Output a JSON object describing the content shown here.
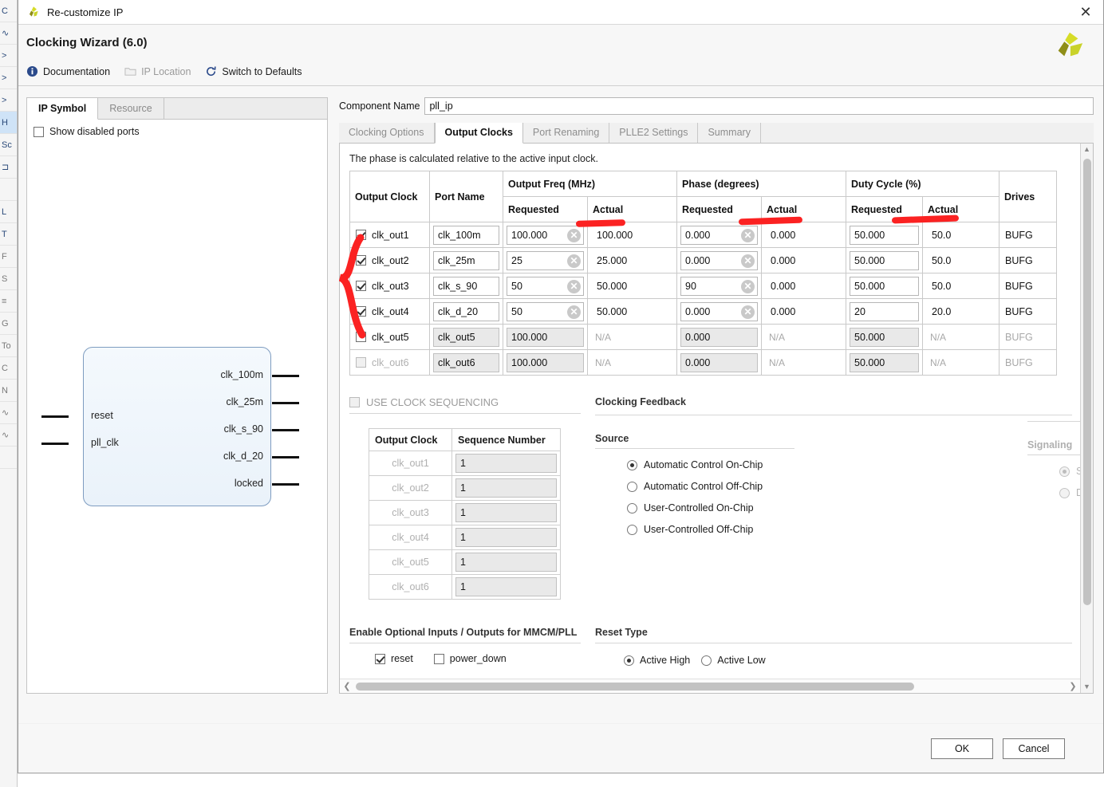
{
  "window": {
    "title": "Re-customize IP",
    "close_label": "✕",
    "icon": "xilinx-logo-icon"
  },
  "header": {
    "wizard_title": "Clocking Wizard (6.0)",
    "logo": "xilinx-logo-icon"
  },
  "toolbar": {
    "items": [
      {
        "label": "Documentation",
        "icon": "info-icon",
        "disabled": false
      },
      {
        "label": "IP Location",
        "icon": "folder-icon",
        "disabled": true
      },
      {
        "label": "Switch to Defaults",
        "icon": "refresh-icon",
        "disabled": false
      }
    ]
  },
  "left_panel": {
    "tabs": [
      {
        "label": "IP Symbol",
        "active": true
      },
      {
        "label": "Resource",
        "active": false
      }
    ],
    "show_disabled_ports": {
      "label": "Show disabled ports",
      "checked": false
    },
    "symbol": {
      "inputs": [
        "reset",
        "pll_clk"
      ],
      "outputs": [
        "clk_100m",
        "clk_25m",
        "clk_s_90",
        "clk_d_20",
        "locked"
      ]
    }
  },
  "component": {
    "label": "Component Name",
    "value": "pll_ip"
  },
  "tabs": [
    {
      "label": "Clocking Options",
      "active": false
    },
    {
      "label": "Output Clocks",
      "active": true
    },
    {
      "label": "Port Renaming",
      "active": false
    },
    {
      "label": "PLLE2 Settings",
      "active": false
    },
    {
      "label": "Summary",
      "active": false
    }
  ],
  "output_clocks": {
    "note": "The phase is calculated relative to the active input clock.",
    "group_headers": {
      "output_clock": "Output Clock",
      "port_name": "Port Name",
      "output_freq": "Output Freq (MHz)",
      "phase": "Phase (degrees)",
      "duty_cycle": "Duty Cycle (%)",
      "drives": "Drives"
    },
    "sub_headers": {
      "requested": "Requested",
      "actual": "Actual"
    },
    "na": "N/A",
    "rows": [
      {
        "name": "clk_out1",
        "checked": true,
        "enabled": true,
        "port": "clk_100m",
        "freq_req": "100.000",
        "freq_act": "100.000",
        "phase_req": "0.000",
        "phase_act": "0.000",
        "duty_req": "50.000",
        "duty_act": "50.0",
        "drives": "BUFG"
      },
      {
        "name": "clk_out2",
        "checked": true,
        "enabled": true,
        "port": "clk_25m",
        "freq_req": "25",
        "freq_act": "25.000",
        "phase_req": "0.000",
        "phase_act": "0.000",
        "duty_req": "50.000",
        "duty_act": "50.0",
        "drives": "BUFG"
      },
      {
        "name": "clk_out3",
        "checked": true,
        "enabled": true,
        "port": "clk_s_90",
        "freq_req": "50",
        "freq_act": "50.000",
        "phase_req": "90",
        "phase_act": "0.000",
        "duty_req": "50.000",
        "duty_act": "50.0",
        "drives": "BUFG"
      },
      {
        "name": "clk_out4",
        "checked": true,
        "enabled": true,
        "port": "clk_d_20",
        "freq_req": "50",
        "freq_act": "50.000",
        "phase_req": "0.000",
        "phase_act": "0.000",
        "duty_req": "20",
        "duty_act": "20.0",
        "drives": "BUFG"
      },
      {
        "name": "clk_out5",
        "checked": false,
        "enabled": true,
        "port": "clk_out5",
        "freq_req": "100.000",
        "freq_act": "N/A",
        "phase_req": "0.000",
        "phase_act": "N/A",
        "duty_req": "50.000",
        "duty_act": "N/A",
        "drives": "BUFG"
      },
      {
        "name": "clk_out6",
        "checked": false,
        "enabled": false,
        "port": "clk_out6",
        "freq_req": "100.000",
        "freq_act": "N/A",
        "phase_req": "0.000",
        "phase_act": "N/A",
        "duty_req": "50.000",
        "duty_act": "N/A",
        "drives": "BUFG"
      }
    ]
  },
  "sequencing": {
    "checkbox_label": "USE CLOCK SEQUENCING",
    "checked": false,
    "headers": {
      "output_clock": "Output Clock",
      "sequence_number": "Sequence Number"
    },
    "rows": [
      {
        "name": "clk_out1",
        "value": "1"
      },
      {
        "name": "clk_out2",
        "value": "1"
      },
      {
        "name": "clk_out3",
        "value": "1"
      },
      {
        "name": "clk_out4",
        "value": "1"
      },
      {
        "name": "clk_out5",
        "value": "1"
      },
      {
        "name": "clk_out6",
        "value": "1"
      }
    ]
  },
  "clocking_feedback": {
    "title": "Clocking Feedback",
    "source": {
      "title": "Source",
      "options": [
        {
          "label": "Automatic Control On-Chip",
          "selected": true
        },
        {
          "label": "Automatic Control Off-Chip",
          "selected": false
        },
        {
          "label": "User-Controlled On-Chip",
          "selected": false
        },
        {
          "label": "User-Controlled Off-Chip",
          "selected": false
        }
      ]
    },
    "signaling": {
      "title": "Signaling",
      "disabled": true,
      "options": [
        {
          "label": "Single-ended",
          "selected": true
        },
        {
          "label": "Differential",
          "selected": false
        }
      ]
    }
  },
  "optional_io": {
    "title": "Enable Optional Inputs / Outputs for MMCM/PLL",
    "items": [
      {
        "label": "reset",
        "checked": true
      },
      {
        "label": "power_down",
        "checked": false
      }
    ]
  },
  "reset_type": {
    "title": "Reset Type",
    "options": [
      {
        "label": "Active High",
        "selected": true
      },
      {
        "label": "Active Low",
        "selected": false
      }
    ]
  },
  "footer": {
    "ok_label": "OK",
    "cancel_label": "Cancel"
  },
  "annotations": {
    "color": "#fb2222",
    "marks": [
      "brace-rows-1-to-4",
      "underline-output-freq",
      "underline-phase",
      "underline-duty-cycle"
    ]
  },
  "background_app": {
    "rows": [
      "C",
      "∿",
      ">",
      ">",
      ">",
      "H",
      "Sc",
      "⊐",
      "",
      "L",
      "T",
      "F",
      "S",
      "≡",
      "G",
      "To",
      "C",
      "N",
      "∿",
      "∿",
      ""
    ]
  }
}
